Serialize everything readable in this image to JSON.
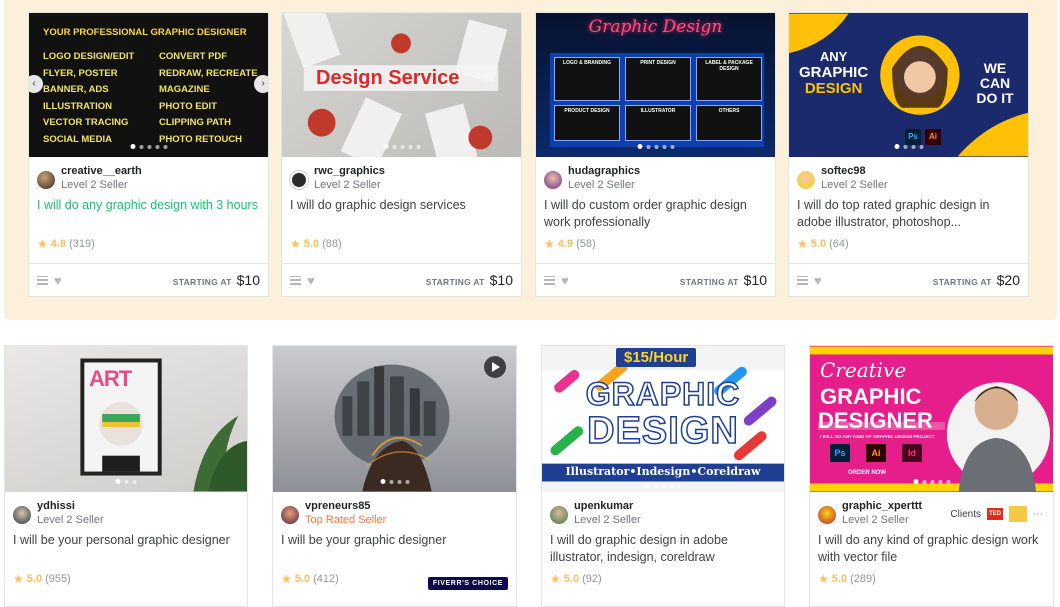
{
  "row1": [
    {
      "username": "creative__earth",
      "level": "Level 2 Seller",
      "title": "I will do any graphic design with 3 hours",
      "rating": "4.8",
      "reviews": "(319)",
      "starting_at": "STARTING AT",
      "price": "$10",
      "thumb": {
        "heading": "YOUR PROFESSIONAL GRAPHIC DESIGNER",
        "left": [
          "LOGO DESIGN/EDIT",
          "FLYER, POSTER",
          "BANNER, ADS",
          "ILLUSTRATION",
          "VECTOR TRACING",
          "SOCIAL MEDIA"
        ],
        "right": [
          "CONVERT PDF",
          "REDRAW, RECREATE",
          "MAGAZINE",
          "PHOTO EDIT",
          "CLIPPING PATH",
          "PHOTO RETOUCH"
        ]
      }
    },
    {
      "username": "rwc_graphics",
      "level": "Level 2 Seller",
      "title": "I will do graphic design services",
      "rating": "5.0",
      "reviews": "(88)",
      "starting_at": "STARTING AT",
      "price": "$10",
      "thumb": {
        "banner": "Design Service"
      }
    },
    {
      "username": "hudagraphics",
      "level": "Level 2 Seller",
      "title": "I will do custom order graphic design work professionally",
      "rating": "4.9",
      "reviews": "(58)",
      "starting_at": "STARTING AT",
      "price": "$10",
      "thumb": {
        "neon": "Graphic Design",
        "boxes": [
          "LOGO & BRANDING",
          "PRINT DESIGN",
          "LABEL & PACKAGE DESIGN",
          "PRODUCT DESIGN",
          "ILLUSTRATOR",
          "OTHERS"
        ]
      }
    },
    {
      "username": "softec98",
      "level": "Level 2 Seller",
      "title": "I will do top rated graphic design in adobe illustrator, photoshop...",
      "rating": "5.0",
      "reviews": "(64)",
      "starting_at": "STARTING AT",
      "price": "$20",
      "thumb": {
        "line1": "ANY",
        "line2": "GRAPHIC",
        "line3": "DESIGN",
        "right": "WE CAN DO IT",
        "ps": "Ps",
        "ai": "Ai"
      }
    }
  ],
  "row2": [
    {
      "username": "ydhissi",
      "level": "Level 2 Seller",
      "title": "I will be your personal graphic designer",
      "rating": "5.0",
      "reviews": "(955)",
      "thumb": {
        "art": "ART"
      }
    },
    {
      "username": "vpreneurs85",
      "level": "Top Rated Seller",
      "title": "I will be your graphic designer",
      "rating": "5.0",
      "reviews": "(412)",
      "badge": "FIVERR'S CHOICE"
    },
    {
      "username": "upenkumar",
      "level": "Level 2 Seller",
      "title": "I will do graphic design in adobe illustrator, indesign, coreldraw",
      "rating": "5.0",
      "reviews": "(92)",
      "thumb": {
        "rate": "$15/Hour",
        "big1": "GRAPHIC",
        "big2": "DESIGN",
        "tools": "Illustrator•Indesign•Coreldraw"
      }
    },
    {
      "username": "graphic_xperttt",
      "level": "Level 2 Seller",
      "title": "I will do any kind of graphic design work with vector file",
      "rating": "5.0",
      "reviews": "(289)",
      "clients": "Clients",
      "ted": "TED",
      "thumb": {
        "script": "Creative",
        "big1": "GRAPHIC",
        "big2": "DESIGNER",
        "sub": "I WILL DO ANY KIND OF GRAPHIC DESIGN PROJECT",
        "order": "ORDER NOW",
        "ps": "Ps",
        "ai": "Ai",
        "id": "Id"
      }
    }
  ]
}
